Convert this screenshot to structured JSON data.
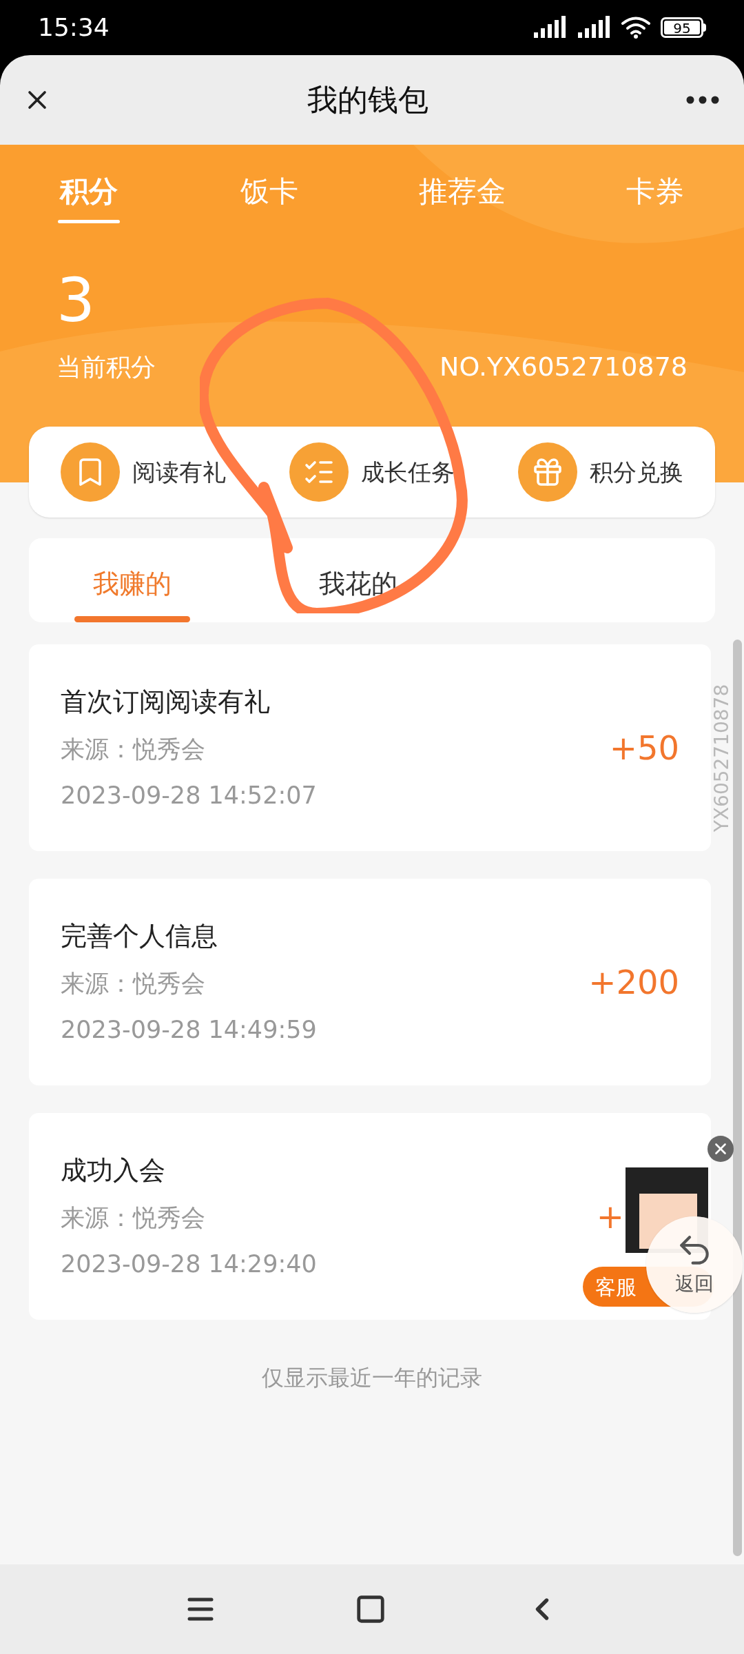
{
  "status_bar": {
    "time": "15:34",
    "battery": "95"
  },
  "header": {
    "title": "我的钱包"
  },
  "tabs": [
    {
      "label": "积分",
      "selected": true
    },
    {
      "label": "饭卡",
      "selected": false
    },
    {
      "label": "推荐金",
      "selected": false
    },
    {
      "label": "卡券",
      "selected": false
    }
  ],
  "points": {
    "value": "3",
    "label": "当前积分",
    "number": "NO.YX6052710878"
  },
  "actions": [
    {
      "label": "阅读有礼",
      "kind": "book"
    },
    {
      "label": "成长任务",
      "kind": "checklist"
    },
    {
      "label": "积分兑换",
      "kind": "gift"
    }
  ],
  "sub_tabs": [
    {
      "label": "我赚的",
      "selected": true
    },
    {
      "label": "我花的",
      "selected": false
    }
  ],
  "records": [
    {
      "title": "首次订阅阅读有礼",
      "source": "来源：悦秀会",
      "time": "2023-09-28 14:52:07",
      "amount": "+50"
    },
    {
      "title": "完善个人信息",
      "source": "来源：悦秀会",
      "time": "2023-09-28 14:49:59",
      "amount": "+200"
    },
    {
      "title": "成功入会",
      "source": "来源：悦秀会",
      "time": "2023-09-28 14:29:40",
      "amount": "+"
    }
  ],
  "footer_note": "仅显示最近一年的记录",
  "side_watermark": "YX6052710878",
  "floating": {
    "service_label": "客服",
    "back_label": "返回"
  }
}
